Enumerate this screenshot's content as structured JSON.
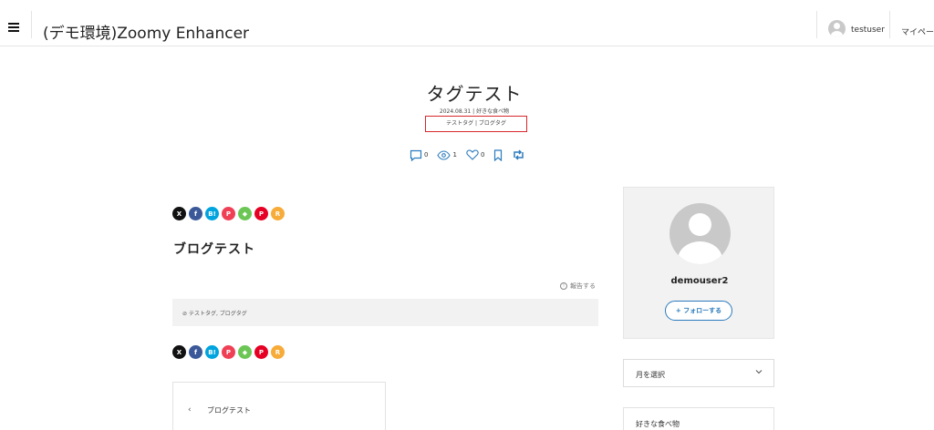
{
  "header": {
    "site_title": "(デモ環境)Zoomy Enhancer",
    "user_name": "testuser",
    "mypage_label": "マイページ"
  },
  "post": {
    "title": "タグテスト",
    "date": "2024.08.31",
    "category": "好きな食べ物",
    "tags_text": "テストタグ | ブログタグ",
    "stats": {
      "comments": "0",
      "views": "1",
      "likes": "0"
    }
  },
  "share": {
    "buttons": [
      {
        "label": "X",
        "icon": "x-icon",
        "color": "#111111"
      },
      {
        "label": "f",
        "icon": "facebook-icon",
        "color": "#3b5998"
      },
      {
        "label": "B!",
        "icon": "hatena-bookmark-icon",
        "color": "#00a4de"
      },
      {
        "label": "P",
        "icon": "pocket-icon",
        "color": "#ef4056"
      },
      {
        "label": "◆",
        "icon": "feedly-icon",
        "color": "#6cc655"
      },
      {
        "label": "P",
        "icon": "pinterest-icon",
        "color": "#e60023"
      },
      {
        "label": "R",
        "icon": "rss-icon",
        "color": "#f7ab38"
      }
    ]
  },
  "article": {
    "heading": "ブログテスト",
    "report_label": "報告する",
    "tag_list": "テストタグ, ブログタグ"
  },
  "navigation": {
    "prev_label": "ブログテスト"
  },
  "sidebar": {
    "profile_name": "demouser2",
    "follow_label": "+ フォローする",
    "month_select_label": "月を選択",
    "category_label": "好きな食べ物"
  },
  "colors": {
    "accent": "#2b7bbd",
    "highlight_border": "#d9262a"
  }
}
